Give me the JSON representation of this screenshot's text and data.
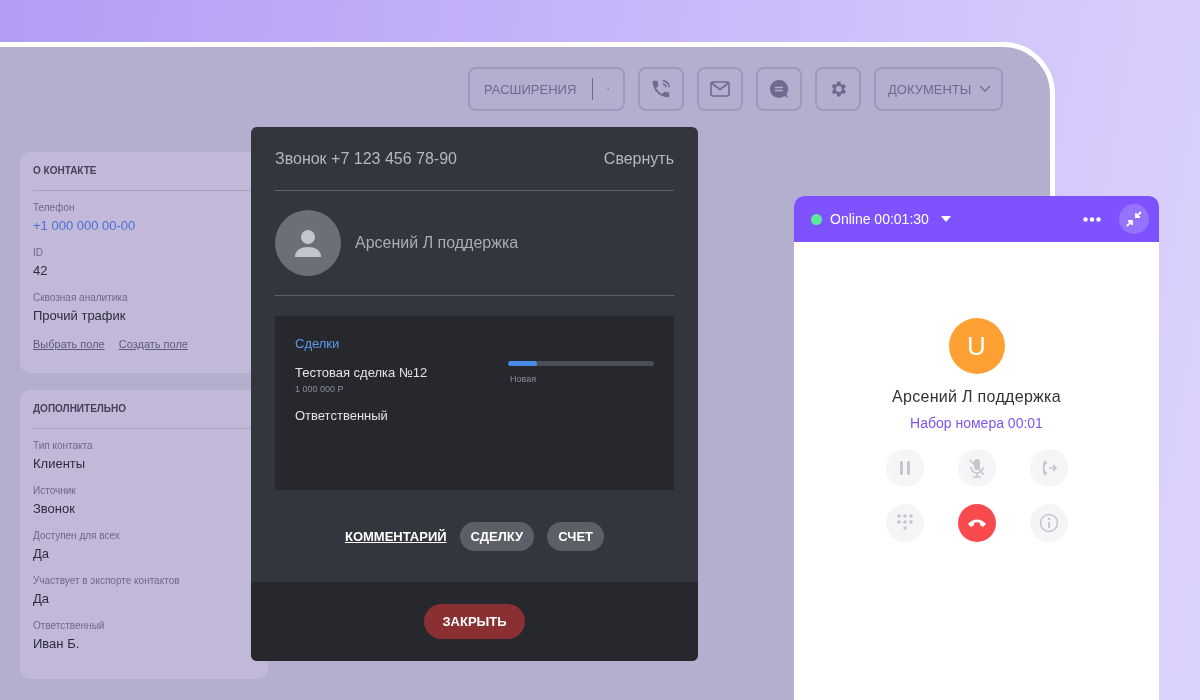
{
  "toolbar": {
    "extensions_button": "РАСШИРЕНИЯ",
    "documents_button": "ДОКУМЕНТЫ"
  },
  "contact_card": {
    "title": "О КОНТАКТЕ",
    "fields": [
      {
        "label": "Телефон",
        "value": "+1 000 000 00-00",
        "kind": "link"
      },
      {
        "label": "ID",
        "value": "42",
        "kind": "text"
      },
      {
        "label": "Сквозная аналитика",
        "value": "Прочий трафик",
        "kind": "text"
      }
    ],
    "links": [
      "Выбрать поле",
      "Создать поле"
    ]
  },
  "extra_card": {
    "title": "ДОПОЛНИТЕЛЬНО",
    "fields": [
      {
        "label": "Тип контакта",
        "value": "Клиенты"
      },
      {
        "label": "Источник",
        "value": "Звонок"
      },
      {
        "label": "Доступен для всех",
        "value": "Да"
      },
      {
        "label": "Участвует в экспорте контактов",
        "value": "Да"
      },
      {
        "label": "Ответственный",
        "value": "Иван Б."
      }
    ]
  },
  "call_modal": {
    "title": "Звонок +7 123 456 78-90",
    "collapse": "Свернуть",
    "contact_name": "Арсений Л поддержка",
    "deals": {
      "title": "Сделки",
      "name": "Тестовая сделка №12",
      "amount": "1 000 000 Р",
      "stage": "Новая",
      "level": 0.2,
      "responsible_label": "Ответственный"
    },
    "actions": [
      {
        "label": "КОММЕНТАРИЙ",
        "kind": "link"
      },
      {
        "label": "СДЕЛКУ",
        "kind": "chip"
      },
      {
        "label": "СЧЕТ",
        "kind": "chip"
      }
    ],
    "close_button": "ЗАКРЫТЬ"
  },
  "widget": {
    "status": "Online",
    "timer": "00:01:30",
    "online": true,
    "avatar_letter": "U",
    "contact_name": "Арсений Л поддержка",
    "call_status": "Набор номера 00:01"
  }
}
